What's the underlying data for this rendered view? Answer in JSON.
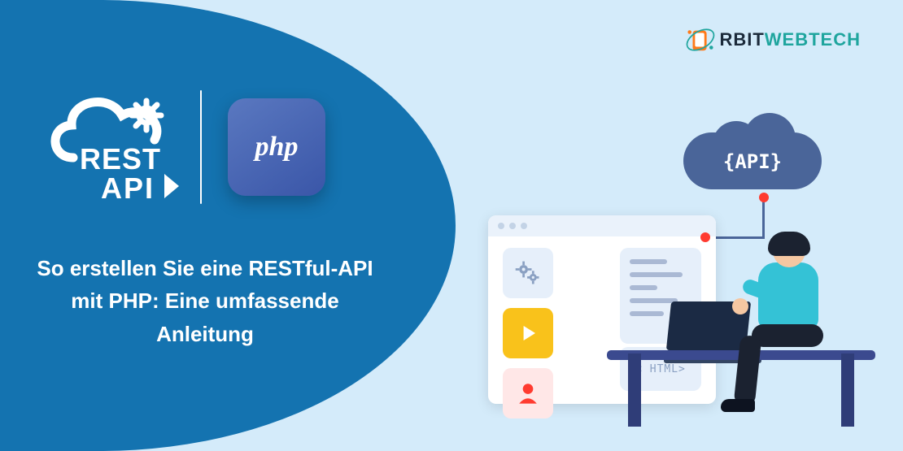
{
  "brand": {
    "name_part1": "RBIT",
    "name_part2": "WEBTECH"
  },
  "left": {
    "rest_line1": "REST",
    "rest_line2": "API",
    "php_label": "php",
    "headline": "So erstellen Sie eine RESTful-API mit PHP: Eine umfassende Anleitung"
  },
  "illus": {
    "api_cloud_label": "{API}",
    "html_panel": "< HTML>"
  },
  "colors": {
    "primary": "#1473b0",
    "bg": "#d4ebfa",
    "cloud": "#4a6599",
    "accent": "#ff3b30",
    "php_grad_a": "#5a78c0",
    "php_grad_b": "#3a56a8"
  }
}
